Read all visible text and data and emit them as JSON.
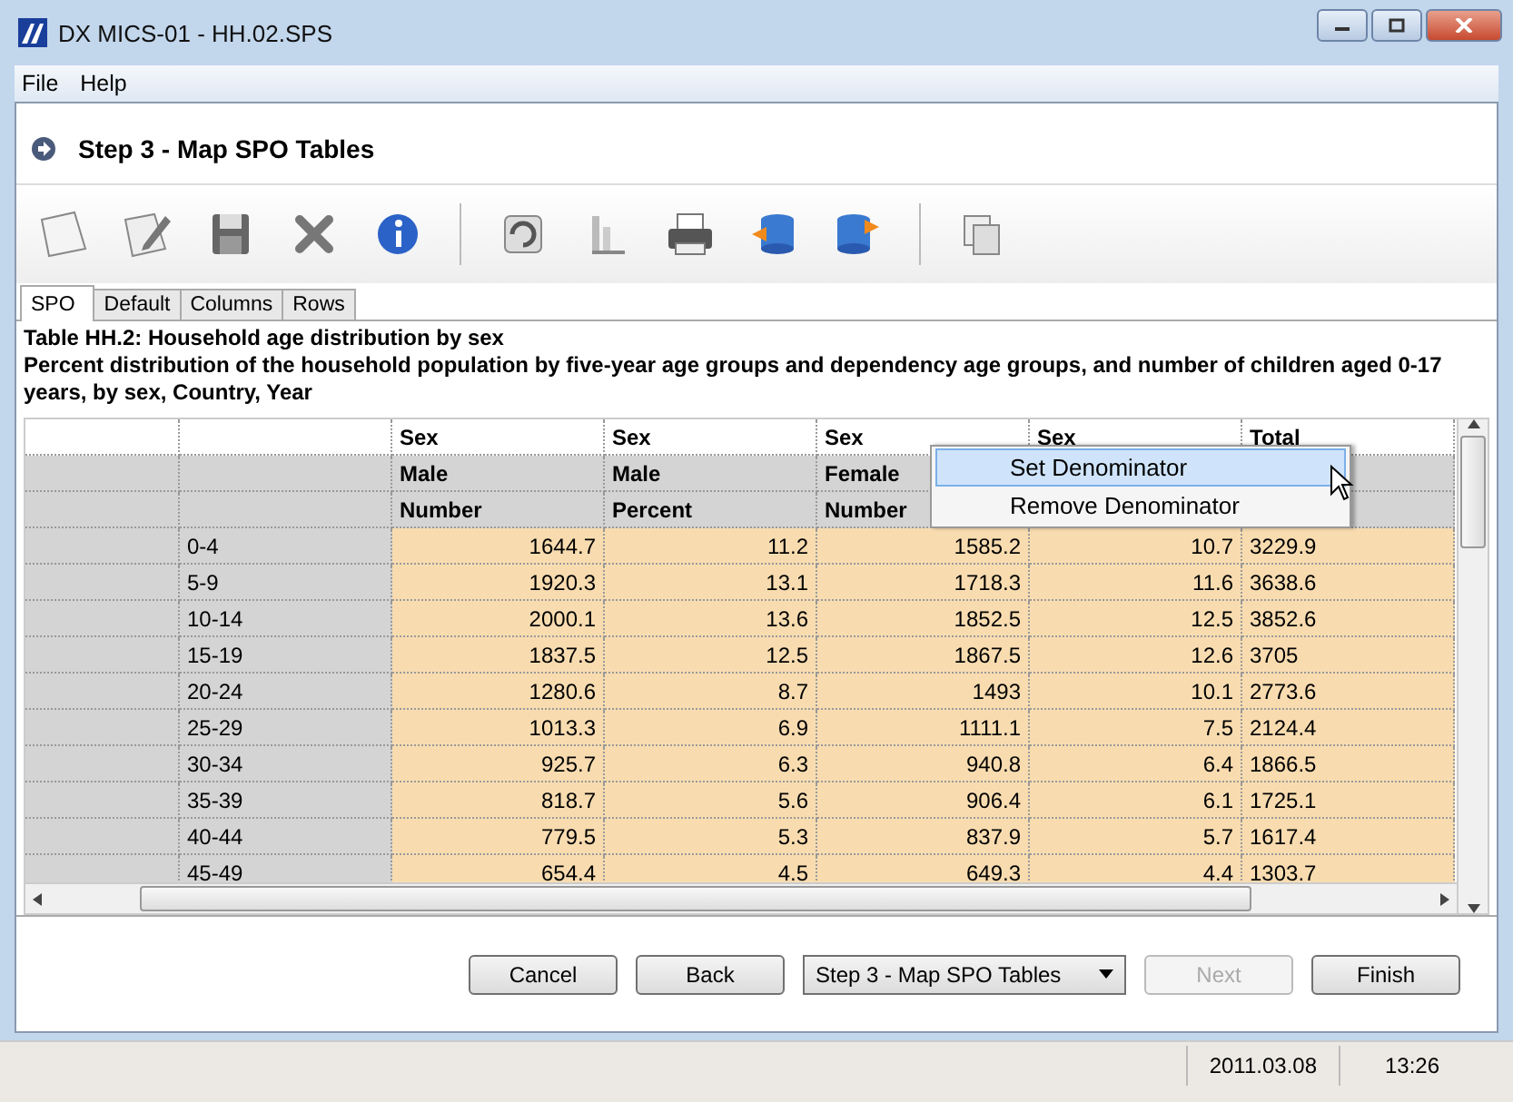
{
  "window": {
    "title": "DX MICS-01 - HH.02.SPS"
  },
  "menu": [
    "File",
    "Help"
  ],
  "step": {
    "title": "Step 3 - Map SPO Tables"
  },
  "tabs": [
    {
      "label": "SPO",
      "selected": true
    },
    {
      "label": "Default",
      "selected": false
    },
    {
      "label": "Columns",
      "selected": false
    },
    {
      "label": "Rows",
      "selected": false
    }
  ],
  "table_title": "Table HH.2: Household age distribution by sex",
  "table_description": "Percent distribution of the household population by five-year age groups and dependency age groups, and number of children aged 0-17 years, by sex, Country, Year",
  "grid": {
    "header_rows": [
      [
        "Sex",
        "Sex",
        "Sex",
        "Sex",
        "Total"
      ],
      [
        "Male",
        "Male",
        "Female"
      ],
      [
        "Number",
        "Percent",
        "Number"
      ]
    ],
    "rows": [
      {
        "label": "0-4",
        "values": [
          "1644.7",
          "11.2",
          "1585.2",
          "10.7",
          "3229.9"
        ]
      },
      {
        "label": "5-9",
        "values": [
          "1920.3",
          "13.1",
          "1718.3",
          "11.6",
          "3638.6"
        ]
      },
      {
        "label": "10-14",
        "values": [
          "2000.1",
          "13.6",
          "1852.5",
          "12.5",
          "3852.6"
        ]
      },
      {
        "label": "15-19",
        "values": [
          "1837.5",
          "12.5",
          "1867.5",
          "12.6",
          "3705"
        ]
      },
      {
        "label": "20-24",
        "values": [
          "1280.6",
          "8.7",
          "1493",
          "10.1",
          "2773.6"
        ]
      },
      {
        "label": "25-29",
        "values": [
          "1013.3",
          "6.9",
          "1111.1",
          "7.5",
          "2124.4"
        ]
      },
      {
        "label": "30-34",
        "values": [
          "925.7",
          "6.3",
          "940.8",
          "6.4",
          "1866.5"
        ]
      },
      {
        "label": "35-39",
        "values": [
          "818.7",
          "5.6",
          "906.4",
          "6.1",
          "1725.1"
        ]
      },
      {
        "label": "40-44",
        "values": [
          "779.5",
          "5.3",
          "837.9",
          "5.7",
          "1617.4"
        ]
      },
      {
        "label": "45-49",
        "values": [
          "654.4",
          "4.5",
          "649.3",
          "4.4",
          "1303.7"
        ]
      }
    ]
  },
  "context_menu": [
    {
      "label": "Set Denominator",
      "selected": true
    },
    {
      "label": "Remove Denominator",
      "selected": false
    }
  ],
  "buttons": [
    {
      "kind": "button",
      "label": "Cancel",
      "disabled": false
    },
    {
      "kind": "button",
      "label": "Back",
      "disabled": false
    },
    {
      "kind": "dropdown",
      "label": "Step 3 - Map SPO Tables",
      "disabled": false
    },
    {
      "kind": "button",
      "label": "Next",
      "disabled": true
    },
    {
      "kind": "button",
      "label": "Finish",
      "disabled": false
    }
  ],
  "status_bar": {
    "date": "2011.03.08",
    "time": "13:26"
  }
}
